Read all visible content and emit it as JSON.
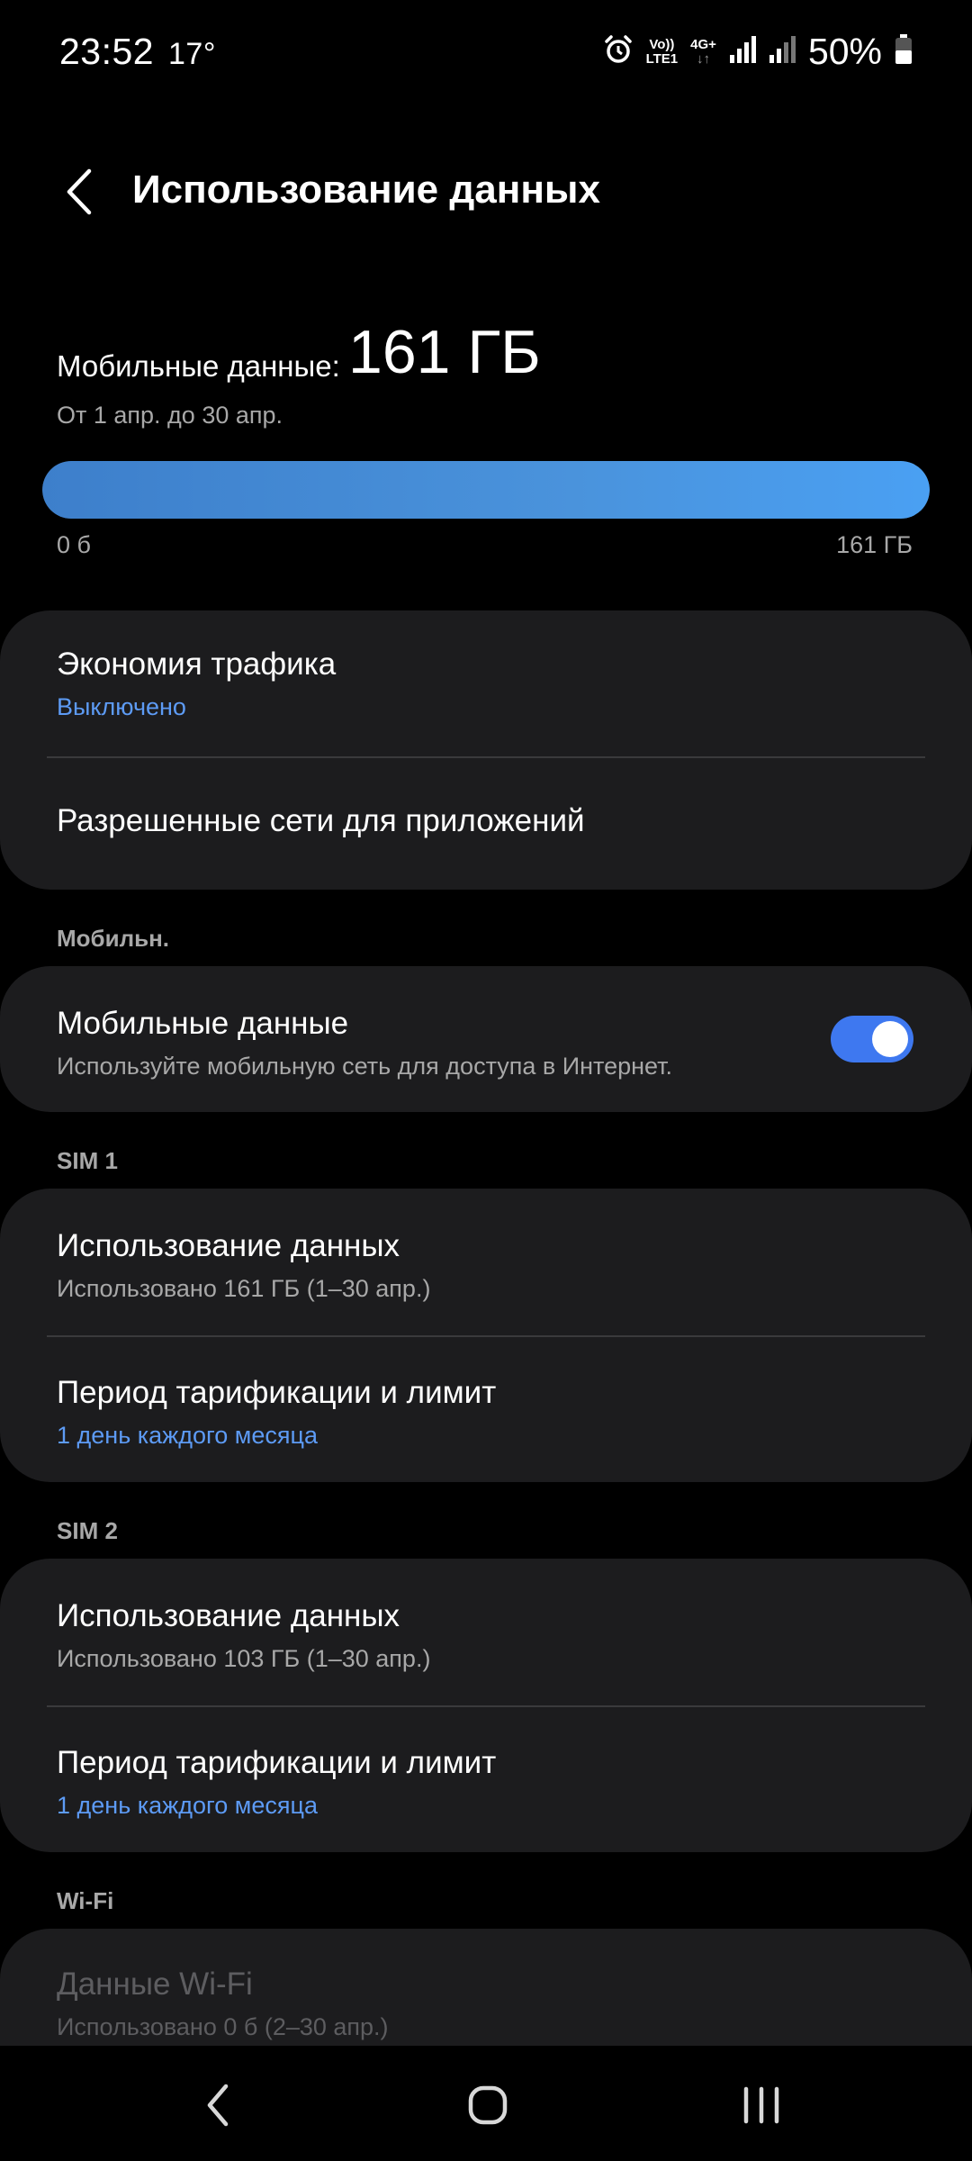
{
  "status_bar": {
    "time": "23:52",
    "temperature": "17°",
    "volte_top": "Vo))",
    "volte_bottom": "LTE1",
    "network_type": "4G+",
    "battery": "50%",
    "icons": [
      "alarm-icon",
      "signal-icon",
      "signal-icon",
      "battery-icon"
    ]
  },
  "header": {
    "title": "Использование данных"
  },
  "usage": {
    "label": "Мобильные данные:",
    "value": "161 ГБ",
    "period": "От 1 апр. до 30 апр.",
    "bar_min": "0 б",
    "bar_max": "161 ГБ",
    "bar_fill_fraction": 1.0,
    "bar_color": "#4a93dc"
  },
  "card1": {
    "saver_title": "Экономия трафика",
    "saver_status": "Выключено",
    "allowed_networks_title": "Разрешенные сети для приложений"
  },
  "section_mobile": {
    "header": "Мобильн.",
    "mobile_data_title": "Мобильные данные",
    "mobile_data_desc": "Используйте мобильную сеть для доступа в Интернет.",
    "toggle_on": true
  },
  "sim1": {
    "header": "SIM 1",
    "usage_title": "Использование данных",
    "usage_sub": "Использовано 161 ГБ (1–30 апр.)",
    "billing_title": "Период тарификации и лимит",
    "billing_sub": "1 день каждого месяца"
  },
  "sim2": {
    "header": "SIM 2",
    "usage_title": "Использование данных",
    "usage_sub": "Использовано 103 ГБ (1–30 апр.)",
    "billing_title": "Период тарификации и лимит",
    "billing_sub": "1 день каждого месяца"
  },
  "wifi": {
    "header": "Wi-Fi",
    "title": "Данные Wi-Fi",
    "sub": "Использовано 0 б (2–30 апр.)"
  },
  "colors": {
    "background": "#000000",
    "card": "#1c1c1e",
    "accent_blue": "#5d9bf5",
    "toggle_on": "#3e78f0"
  },
  "nav": {
    "icons": [
      "back-nav-icon",
      "home-nav-icon",
      "recents-nav-icon"
    ]
  }
}
